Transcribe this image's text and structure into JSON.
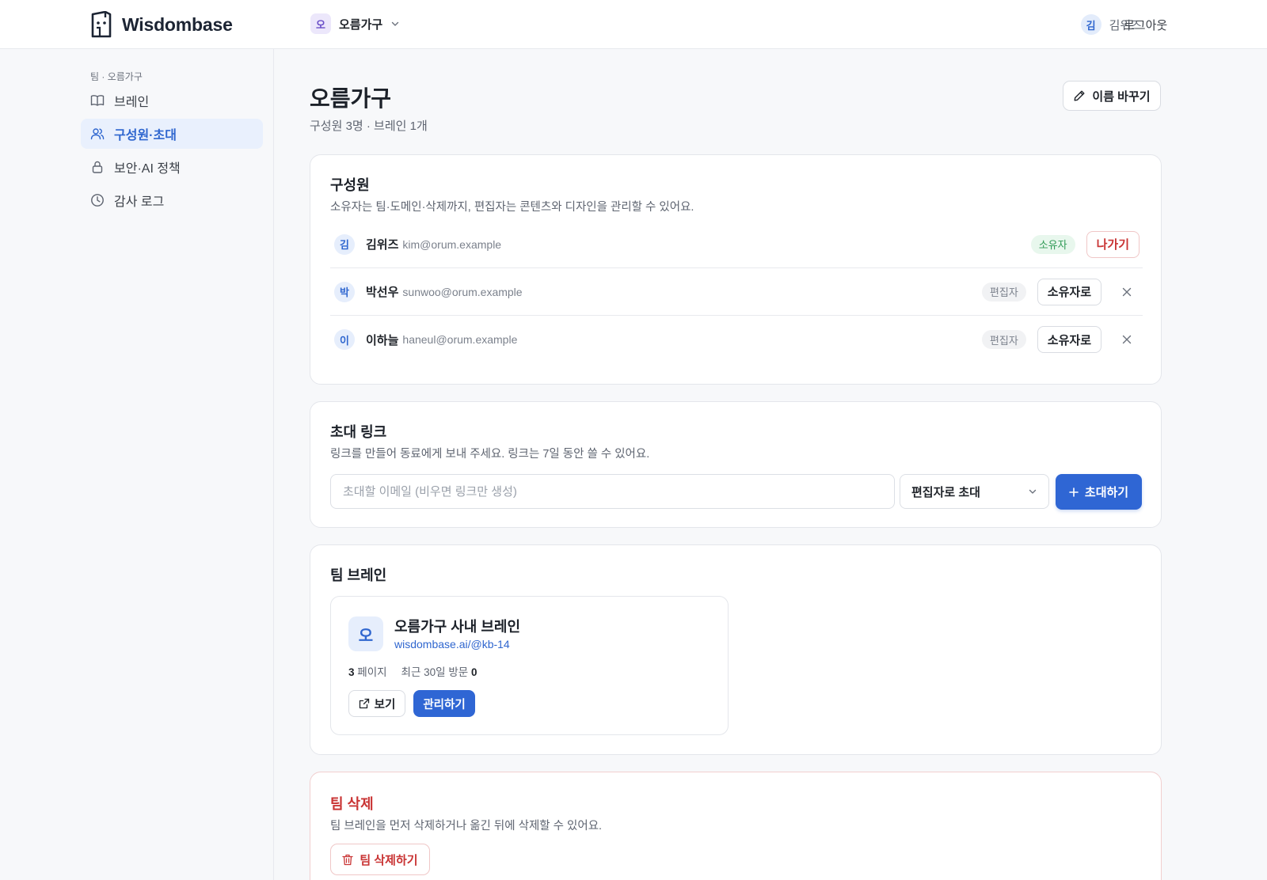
{
  "app": {
    "name": "Wisdombase",
    "team_avatar": "오",
    "team_name": "오름가구",
    "user_avatar": "김",
    "user_name": "김위즈",
    "logout": "로그아웃"
  },
  "sidebar": {
    "crumb": "팀 · 오름가구",
    "items": [
      {
        "label": "브레인",
        "icon": "book-icon"
      },
      {
        "label": "구성원·초대",
        "icon": "users-icon",
        "active": true
      },
      {
        "label": "보안·AI 정책",
        "icon": "lock-icon"
      },
      {
        "label": "감사 로그",
        "icon": "clock-icon"
      }
    ]
  },
  "page": {
    "title": "오름가구",
    "subtitle": "구성원 3명 · 브레인 1개",
    "rename_label": "이름 바꾸기"
  },
  "members": {
    "title": "구성원",
    "desc": "소유자는 팀·도메인·삭제까지, 편집자는 콘텐츠와 디자인을 관리할 수 있어요.",
    "rows": [
      {
        "avatar": "김",
        "name": "김위즈",
        "email": "kim@orum.example",
        "role": "소유자",
        "action": "나가기"
      },
      {
        "avatar": "박",
        "name": "박선우",
        "email": "sunwoo@orum.example",
        "role": "편집자",
        "action": "소유자로"
      },
      {
        "avatar": "이",
        "name": "이하늘",
        "email": "haneul@orum.example",
        "role": "편집자",
        "action": "소유자로"
      }
    ]
  },
  "invite": {
    "title": "초대 링크",
    "desc": "링크를 만들어 동료에게 보내 주세요. 링크는 7일 동안 쓸 수 있어요.",
    "email_placeholder": "초대할 이메일 (비우면 링크만 생성)",
    "email_value": "",
    "role_selected": "편집자로 초대",
    "submit_label": "초대하기"
  },
  "brain": {
    "title": "팀 브레인",
    "avatar": "오",
    "name": "오름가구 사내 브레인",
    "url": "wisdombase.ai/@kb-14",
    "pages_count": "3",
    "pages_label": "페이지",
    "visits_label": "최근 30일 방문",
    "visits_count": "0",
    "view_label": "보기",
    "manage_label": "관리하기"
  },
  "danger": {
    "title": "팀 삭제",
    "desc": "팀 브레인을 먼저 삭제하거나 옮긴 뒤에 삭제할 수 있어요.",
    "delete_label": "팀 삭제하기"
  },
  "colors": {
    "accent": "#2f66d4",
    "danger": "#c93434",
    "owner_badge": "#2f9a55"
  }
}
